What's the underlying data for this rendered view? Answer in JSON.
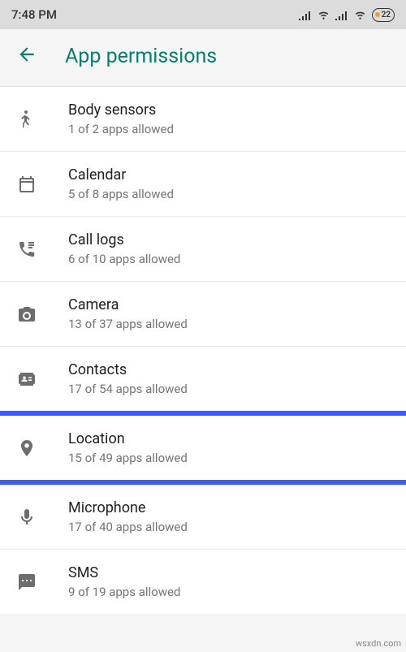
{
  "status": {
    "time": "7:48 PM",
    "battery": "22"
  },
  "header": {
    "title": "App permissions"
  },
  "permissions": [
    {
      "id": "body-sensors",
      "title": "Body sensors",
      "sub": "1 of 2 apps allowed"
    },
    {
      "id": "calendar",
      "title": "Calendar",
      "sub": "5 of 8 apps allowed"
    },
    {
      "id": "call-logs",
      "title": "Call logs",
      "sub": "6 of 10 apps allowed"
    },
    {
      "id": "camera",
      "title": "Camera",
      "sub": "13 of 37 apps allowed"
    },
    {
      "id": "contacts",
      "title": "Contacts",
      "sub": "17 of 54 apps allowed"
    },
    {
      "id": "location",
      "title": "Location",
      "sub": "15 of 49 apps allowed"
    },
    {
      "id": "microphone",
      "title": "Microphone",
      "sub": "17 of 40 apps allowed"
    },
    {
      "id": "sms",
      "title": "SMS",
      "sub": "9 of 19 apps allowed"
    }
  ],
  "watermark": "wsxdn.com"
}
